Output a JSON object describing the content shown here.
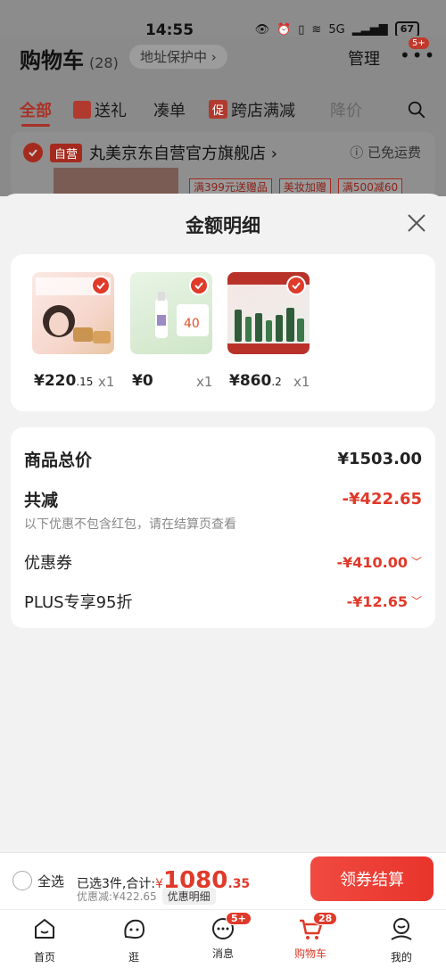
{
  "status_bar": {
    "time": "14:55",
    "battery": "67",
    "signal": "5G"
  },
  "header": {
    "title": "购物车",
    "count": "(28)",
    "address": "地址保护中 ›",
    "manage": "管理",
    "more_badge": "5+"
  },
  "tabs": [
    {
      "label": "全部"
    },
    {
      "label": "送礼"
    },
    {
      "label": "凑单"
    },
    {
      "tag": "促",
      "label": "跨店满减"
    },
    {
      "label": "降价"
    }
  ],
  "store": {
    "tag": "自营",
    "name": "丸美京东自营官方旗舰店 ›",
    "shipping": "ⓘ 已免运费",
    "promos": [
      "满399元送赠品",
      "美妆加赠",
      "满500减60"
    ]
  },
  "sheet": {
    "title": "金额明细",
    "goods": [
      {
        "price_main": "¥220",
        "price_dec": ".15",
        "qty": "x1"
      },
      {
        "price_main": "¥0",
        "price_dec": "",
        "qty": "x1"
      },
      {
        "price_main": "¥860",
        "price_dec": ".2",
        "qty": "x1"
      }
    ],
    "total_label": "商品总价",
    "total_value": "¥1503.00",
    "reduce_label": "共减",
    "reduce_value": "-¥422.65",
    "note": "以下优惠不包含红包，请在结算页查看",
    "coupon_label": "优惠券",
    "coupon_value": "-¥410.00",
    "plus_label": "PLUS专享95折",
    "plus_value": "-¥12.65"
  },
  "checkout": {
    "select_all": "全选",
    "selected_text": "已选3件,合计:",
    "currency": "¥",
    "amount_main": "1080",
    "amount_dec": ".35",
    "discount_text": "优惠减:¥422.65",
    "detail_button": "优惠明细",
    "pay_button": "领券结算"
  },
  "nav": [
    {
      "label": "首页",
      "badge": ""
    },
    {
      "label": "逛",
      "badge": ""
    },
    {
      "label": "消息",
      "badge": "5+"
    },
    {
      "label": "购物车",
      "badge": "28"
    },
    {
      "label": "我的",
      "badge": ""
    }
  ]
}
